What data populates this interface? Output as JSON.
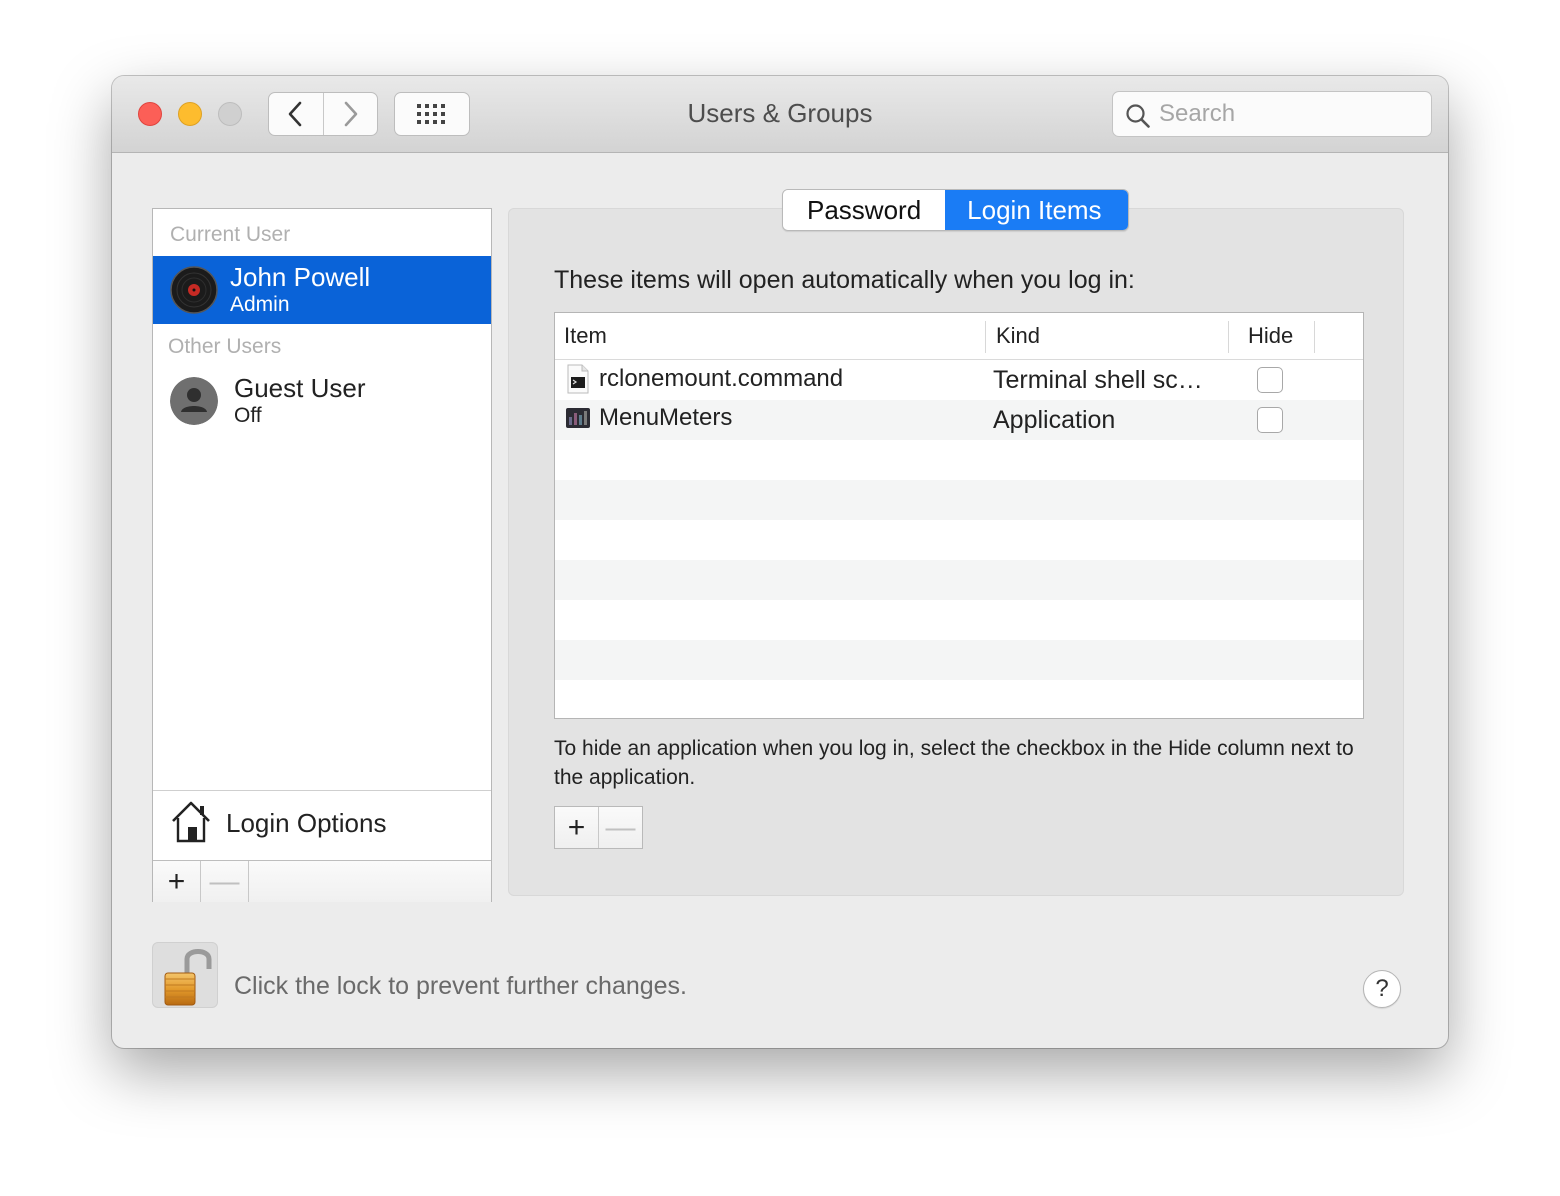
{
  "window": {
    "title": "Users & Groups"
  },
  "toolbar": {
    "back_icon": "chevron-left-icon",
    "forward_icon": "chevron-right-icon",
    "grid_icon": "grid-icon",
    "search": {
      "placeholder": "Search",
      "value": ""
    }
  },
  "sidebar": {
    "current_header": "Current User",
    "current_user": {
      "name": "John Powell",
      "role": "Admin",
      "avatar": "record-avatar-icon"
    },
    "other_header": "Other Users",
    "other_users": [
      {
        "name": "Guest User",
        "status": "Off",
        "avatar": "person-avatar-icon"
      }
    ],
    "login_options": {
      "label": "Login Options",
      "icon": "house-icon"
    },
    "add_label": "+",
    "remove_label": "—"
  },
  "tabs": [
    {
      "label": "Password",
      "active": false
    },
    {
      "label": "Login Items",
      "active": true
    }
  ],
  "login_items": {
    "intro": "These items will open automatically when you log in:",
    "columns": {
      "item": "Item",
      "kind": "Kind",
      "hide": "Hide"
    },
    "rows": [
      {
        "item": "rclonemount.command",
        "kind": "Terminal shell sc…",
        "hide": false,
        "icon": "terminal-script-icon"
      },
      {
        "item": "MenuMeters",
        "kind": "Application",
        "hide": false,
        "icon": "menumeters-app-icon"
      }
    ],
    "hint": "To hide an application when you log in, select the checkbox in the Hide column next to the application.",
    "add_label": "+",
    "remove_label": "—"
  },
  "footer": {
    "lock_text": "Click the lock to prevent further changes.",
    "lock_icon": "unlocked-padlock-icon",
    "help_label": "?"
  },
  "colors": {
    "selection": "#0a63d8",
    "tab_active": "#1a7cf5",
    "close": "#fc5f57",
    "minimize": "#fdbc2e"
  }
}
